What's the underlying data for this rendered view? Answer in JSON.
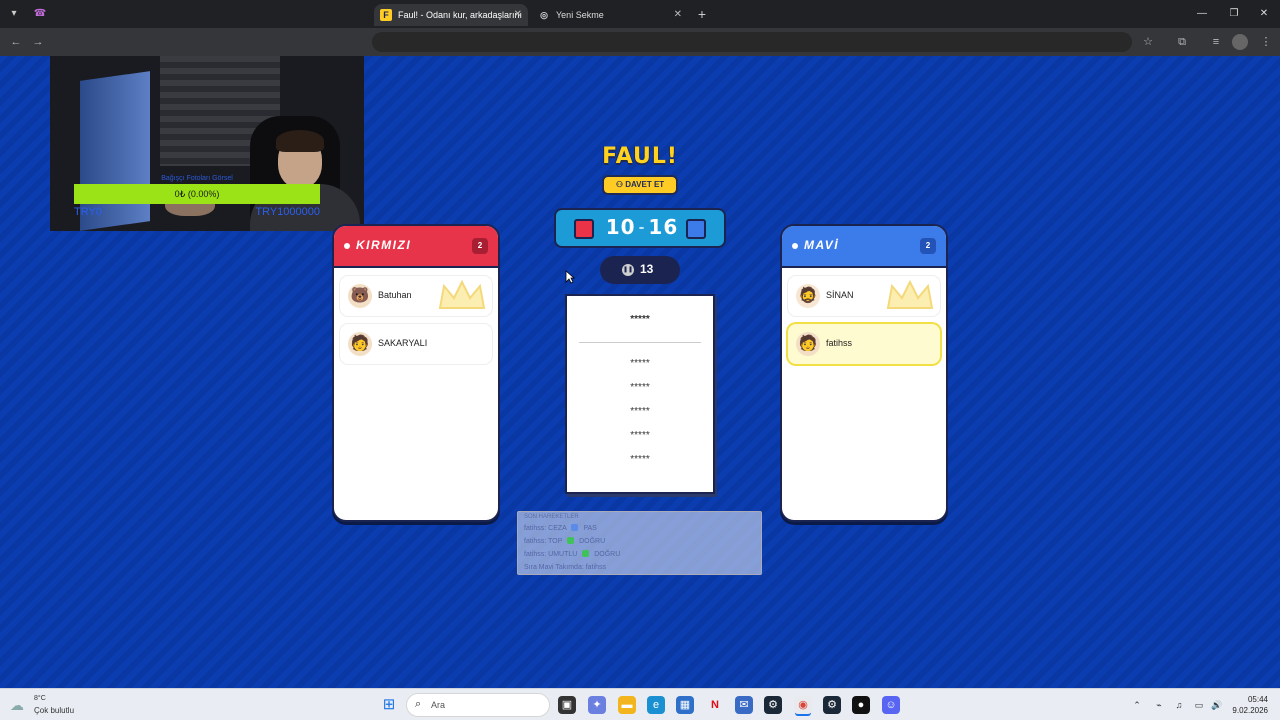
{
  "browser": {
    "tabs": [
      {
        "title": "Faul! - Odanı kur, arkadaşlarını",
        "favicon": "F",
        "active": true
      },
      {
        "title": "Yeni Sekme",
        "favicon": "globe",
        "active": false
      }
    ],
    "new_tab": "+",
    "window_controls": [
      "minimize",
      "restore",
      "close"
    ]
  },
  "stream_overlay": {
    "donation_title": "Bağışçı Fotoları Görsel",
    "progress_text": "0₺ (0.00%)",
    "progress_fraction": 0,
    "min_label": "TRY0",
    "max_label": "TRY1000000"
  },
  "game": {
    "title": "FAUL!",
    "invite_label": "DAVET ET",
    "score": {
      "red": "10",
      "separator": "-",
      "blue": "16"
    },
    "timer": "13",
    "teams": {
      "red": {
        "name": "KIRMIZI",
        "count": "2",
        "players": [
          {
            "name": "Batuhan",
            "leader": true,
            "me": false
          },
          {
            "name": "SAKARYALI",
            "leader": false,
            "me": false
          }
        ]
      },
      "blue": {
        "name": "MAVİ",
        "count": "2",
        "players": [
          {
            "name": "SİNAN",
            "leader": true,
            "me": false
          },
          {
            "name": "fatihss",
            "leader": false,
            "me": true
          }
        ]
      }
    },
    "card": {
      "main_word": "*****",
      "forbidden": [
        "*****",
        "*****",
        "*****",
        "*****",
        "*****"
      ]
    },
    "recent_moves": {
      "header": "SON HAREKETLER",
      "lines": [
        {
          "who": "fatihss:",
          "word": "CEZA",
          "result": "PAS",
          "color": "#5a8be8"
        },
        {
          "who": "fatihss:",
          "word": "TOP",
          "result": "DOĞRU",
          "color": "#3fc25a"
        },
        {
          "who": "fatihss:",
          "word": "UMUTLU",
          "result": "DOĞRU",
          "color": "#3fc25a"
        }
      ],
      "status": "Sıra Mavi Takımda: fatihss"
    }
  },
  "taskbar": {
    "weather_temp": "8°C",
    "weather_desc": "Çok bulutlu",
    "search_placeholder": "Ara",
    "time": "05:44",
    "date": "9.02.2026"
  }
}
